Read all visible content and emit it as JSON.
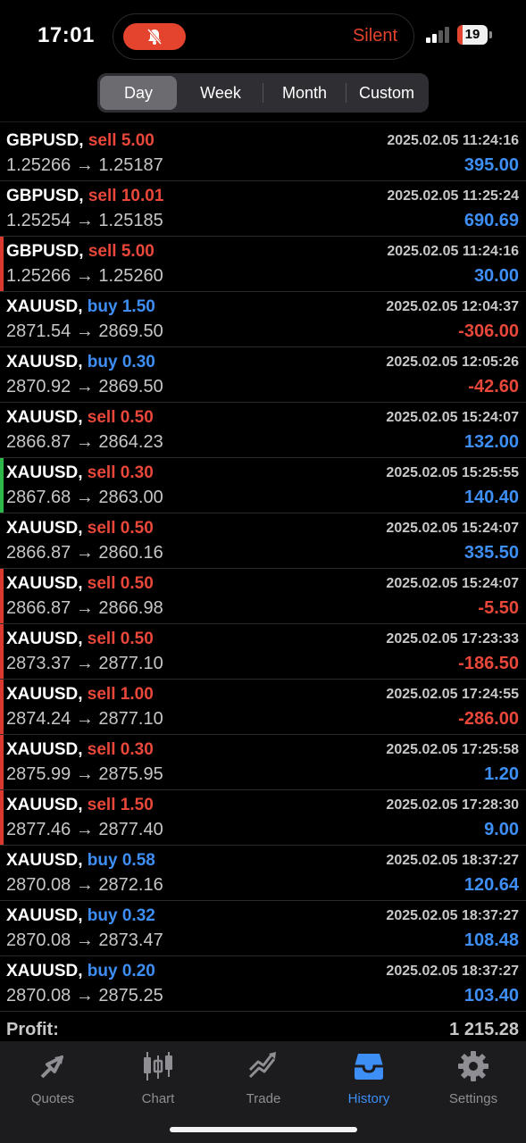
{
  "status_bar": {
    "time": "17:01",
    "silent_label": "Silent",
    "battery_level": "19",
    "battery_fraction": 0.19,
    "bell_icon": "bell-slash-icon",
    "accent": "#e4432d"
  },
  "period_tabs": [
    {
      "label": "Day",
      "active": true
    },
    {
      "label": "Week",
      "active": false
    },
    {
      "label": "Month",
      "active": false
    },
    {
      "label": "Custom",
      "active": false
    }
  ],
  "deals": [
    {
      "symbol": "GBPUSD,",
      "side": "sell",
      "volume": "5.00",
      "time": "2025.02.05 11:24:16",
      "open": "1.25266",
      "close": "1.25187",
      "profit": "395.00",
      "profit_sign": "pos",
      "marker": ""
    },
    {
      "symbol": "GBPUSD,",
      "side": "sell",
      "volume": "10.01",
      "time": "2025.02.05 11:25:24",
      "open": "1.25254",
      "close": "1.25185",
      "profit": "690.69",
      "profit_sign": "pos",
      "marker": ""
    },
    {
      "symbol": "GBPUSD,",
      "side": "sell",
      "volume": "5.00",
      "time": "2025.02.05 11:24:16",
      "open": "1.25266",
      "close": "1.25260",
      "profit": "30.00",
      "profit_sign": "pos",
      "marker": "#d9392f"
    },
    {
      "symbol": "XAUUSD,",
      "side": "buy",
      "volume": "1.50",
      "time": "2025.02.05 12:04:37",
      "open": "2871.54",
      "close": "2869.50",
      "profit": "-306.00",
      "profit_sign": "neg",
      "marker": ""
    },
    {
      "symbol": "XAUUSD,",
      "side": "buy",
      "volume": "0.30",
      "time": "2025.02.05 12:05:26",
      "open": "2870.92",
      "close": "2869.50",
      "profit": "-42.60",
      "profit_sign": "neg",
      "marker": ""
    },
    {
      "symbol": "XAUUSD,",
      "side": "sell",
      "volume": "0.50",
      "time": "2025.02.05 15:24:07",
      "open": "2866.87",
      "close": "2864.23",
      "profit": "132.00",
      "profit_sign": "pos",
      "marker": ""
    },
    {
      "symbol": "XAUUSD,",
      "side": "sell",
      "volume": "0.30",
      "time": "2025.02.05 15:25:55",
      "open": "2867.68",
      "close": "2863.00",
      "profit": "140.40",
      "profit_sign": "pos",
      "marker": "#2fb84a"
    },
    {
      "symbol": "XAUUSD,",
      "side": "sell",
      "volume": "0.50",
      "time": "2025.02.05 15:24:07",
      "open": "2866.87",
      "close": "2860.16",
      "profit": "335.50",
      "profit_sign": "pos",
      "marker": ""
    },
    {
      "symbol": "XAUUSD,",
      "side": "sell",
      "volume": "0.50",
      "time": "2025.02.05 15:24:07",
      "open": "2866.87",
      "close": "2866.98",
      "profit": "-5.50",
      "profit_sign": "neg",
      "marker": "#d9392f"
    },
    {
      "symbol": "XAUUSD,",
      "side": "sell",
      "volume": "0.50",
      "time": "2025.02.05 17:23:33",
      "open": "2873.37",
      "close": "2877.10",
      "profit": "-186.50",
      "profit_sign": "neg",
      "marker": "#d9392f"
    },
    {
      "symbol": "XAUUSD,",
      "side": "sell",
      "volume": "1.00",
      "time": "2025.02.05 17:24:55",
      "open": "2874.24",
      "close": "2877.10",
      "profit": "-286.00",
      "profit_sign": "neg",
      "marker": "#d9392f"
    },
    {
      "symbol": "XAUUSD,",
      "side": "sell",
      "volume": "0.30",
      "time": "2025.02.05 17:25:58",
      "open": "2875.99",
      "close": "2875.95",
      "profit": "1.20",
      "profit_sign": "pos",
      "marker": "#d9392f"
    },
    {
      "symbol": "XAUUSD,",
      "side": "sell",
      "volume": "1.50",
      "time": "2025.02.05 17:28:30",
      "open": "2877.46",
      "close": "2877.40",
      "profit": "9.00",
      "profit_sign": "pos",
      "marker": "#d9392f"
    },
    {
      "symbol": "XAUUSD,",
      "side": "buy",
      "volume": "0.58",
      "time": "2025.02.05 18:37:27",
      "open": "2870.08",
      "close": "2872.16",
      "profit": "120.64",
      "profit_sign": "pos",
      "marker": ""
    },
    {
      "symbol": "XAUUSD,",
      "side": "buy",
      "volume": "0.32",
      "time": "2025.02.05 18:37:27",
      "open": "2870.08",
      "close": "2873.47",
      "profit": "108.48",
      "profit_sign": "pos",
      "marker": ""
    },
    {
      "symbol": "XAUUSD,",
      "side": "buy",
      "volume": "0.20",
      "time": "2025.02.05 18:37:27",
      "open": "2870.08",
      "close": "2875.25",
      "profit": "103.40",
      "profit_sign": "pos",
      "marker": ""
    }
  ],
  "arrow": "→",
  "summary": {
    "profit_label": "Profit:",
    "profit_value": "1 215.28"
  },
  "tab_bar": [
    {
      "label": "Quotes",
      "icon": "quotes-icon",
      "active": false
    },
    {
      "label": "Chart",
      "icon": "candlestick-chart-icon",
      "active": false
    },
    {
      "label": "Trade",
      "icon": "trade-icon",
      "active": false
    },
    {
      "label": "History",
      "icon": "history-inbox-icon",
      "active": true
    },
    {
      "label": "Settings",
      "icon": "gear-icon",
      "active": false
    }
  ],
  "colors": {
    "sell": "#e8473a",
    "buy": "#3d8ef5",
    "positive": "#3d8ef5",
    "negative": "#e8473a",
    "active_tab": "#3d8ef5"
  }
}
